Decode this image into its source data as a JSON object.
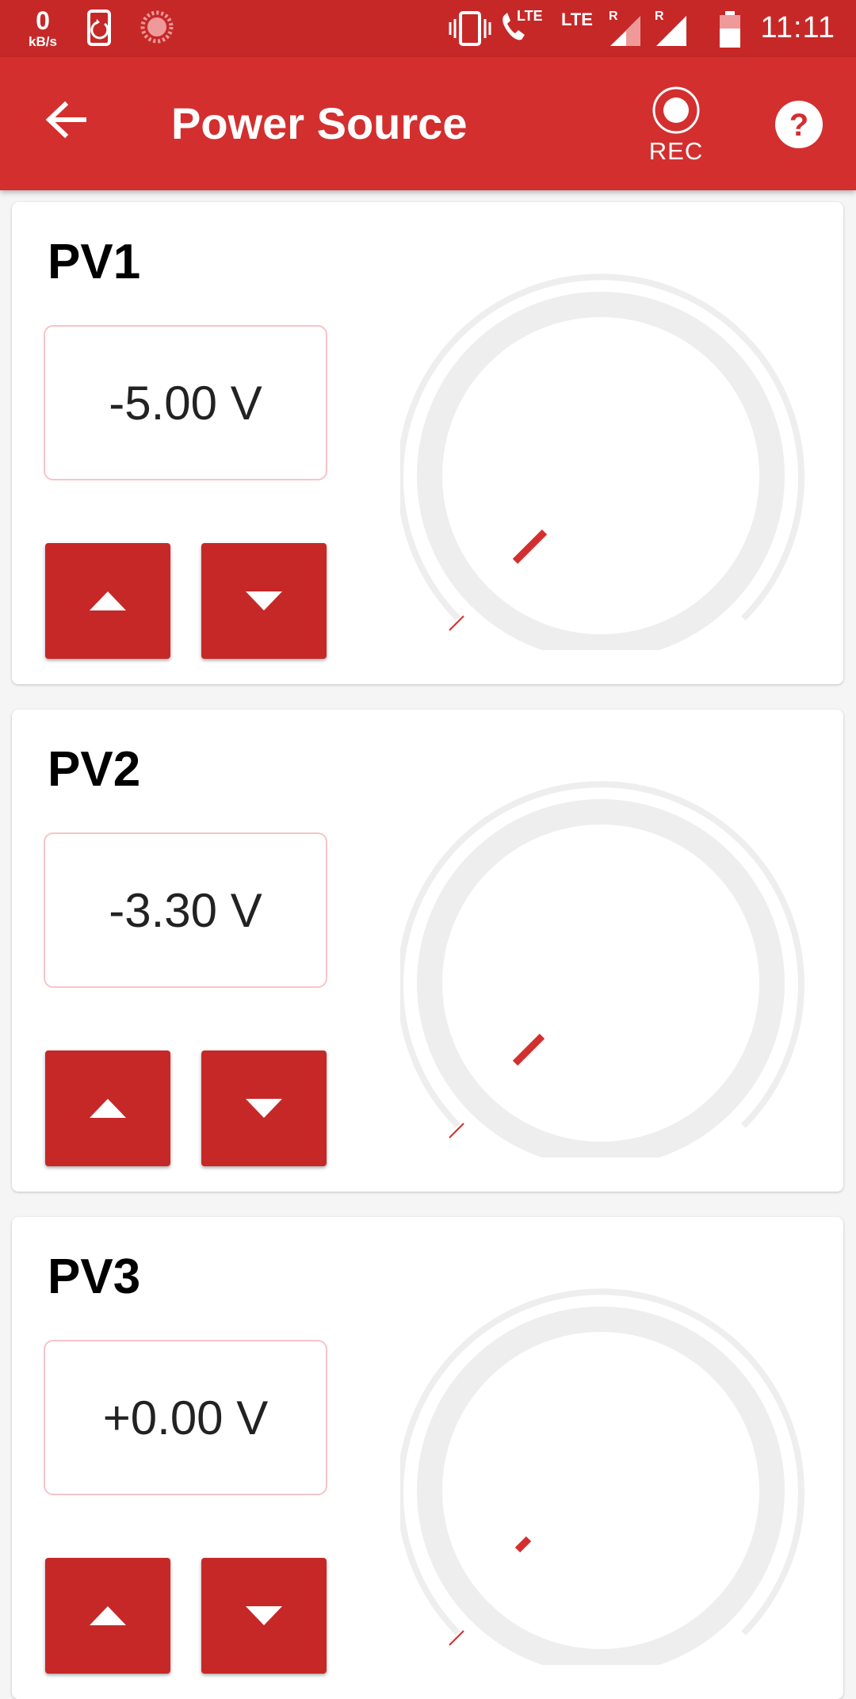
{
  "status_bar": {
    "net_speed_value": "0",
    "net_speed_unit": "kB/s",
    "lte_call_label": "LTE",
    "lte_label": "LTE",
    "roaming_1": "R",
    "roaming_2": "R",
    "time": "11:11",
    "icons": [
      "phone-sync-icon",
      "loading-icon",
      "vibrate-icon",
      "lte-call-icon",
      "signal-icon",
      "signal-icon",
      "battery-icon"
    ]
  },
  "app_bar": {
    "title": "Power Source",
    "rec_label": "REC",
    "icons": [
      "back-arrow-icon",
      "record-icon",
      "help-icon"
    ]
  },
  "colors": {
    "primary": "#d32f2f",
    "primary_dark": "#c62828",
    "knob_track": "#eeeeee",
    "value_border": "#f6c4c8"
  },
  "sources": [
    {
      "name": "PV1",
      "value": "-5.00 V"
    },
    {
      "name": "PV2",
      "value": "-3.30 V"
    },
    {
      "name": "PV3",
      "value": "+0.00 V"
    }
  ]
}
